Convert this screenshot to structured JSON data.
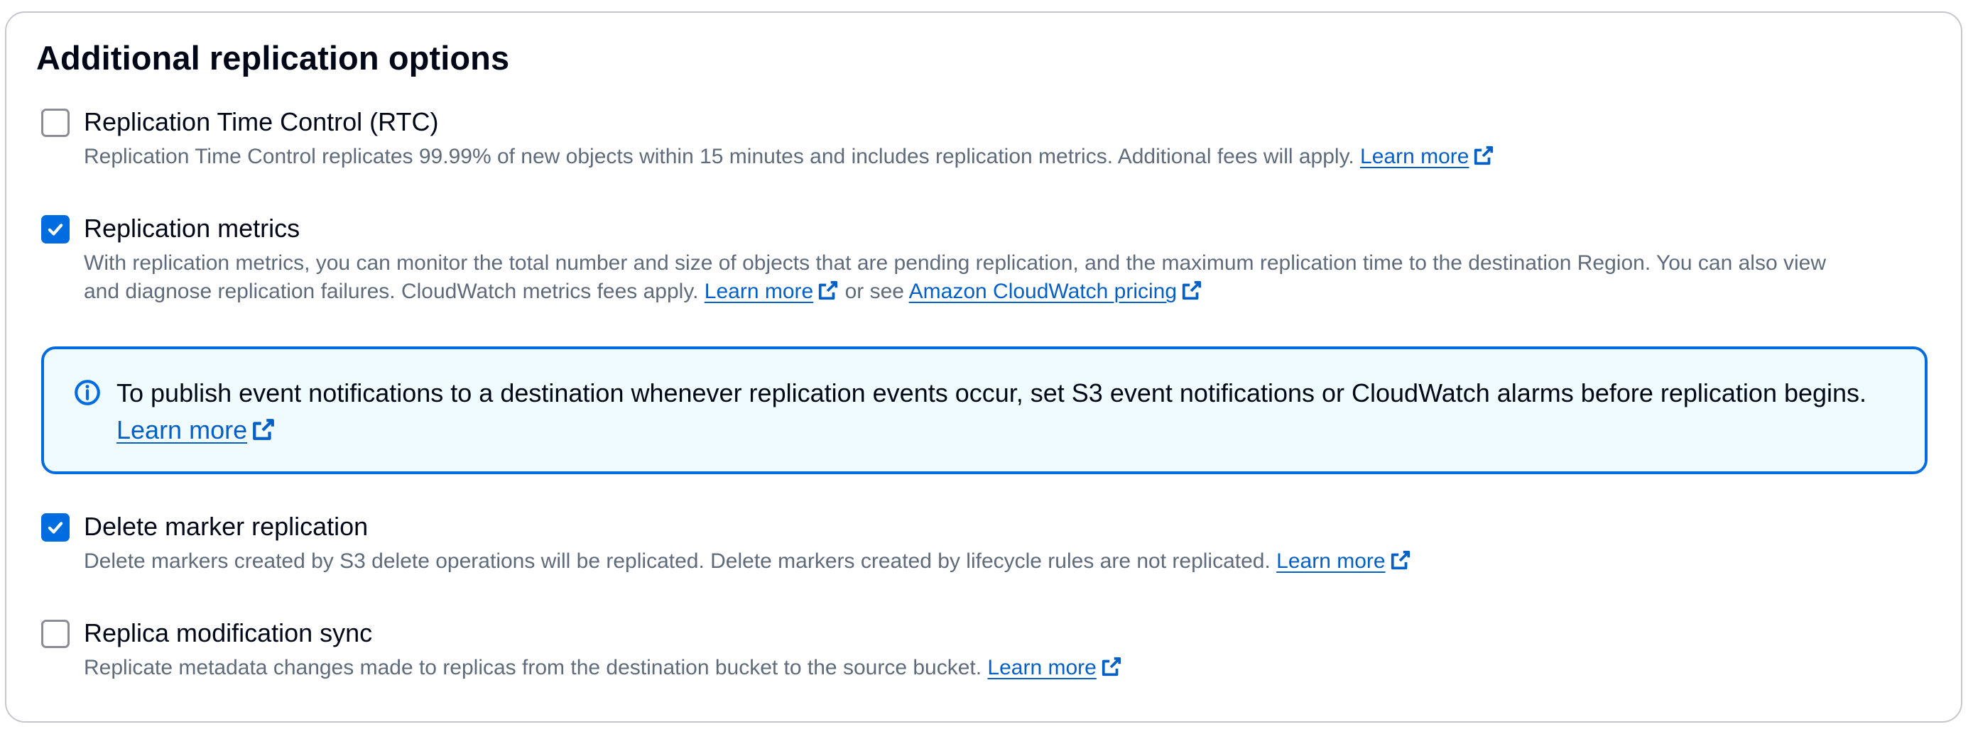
{
  "section": {
    "title": "Additional replication options"
  },
  "options": [
    {
      "label": "Replication Time Control (RTC)",
      "checked": false,
      "description": "Replication Time Control replicates 99.99% of new objects within 15 minutes and includes replication metrics. Additional fees will apply.",
      "link": "Learn more"
    },
    {
      "label": "Replication metrics",
      "checked": true,
      "description_line1": "With replication metrics, you can monitor the total number and size of objects that are pending replication, and the maximum replication time to the destination Region. You can also view",
      "description_line2": "and diagnose replication failures. CloudWatch metrics fees apply.",
      "link": "Learn more",
      "connector": "or see",
      "link2": "Amazon CloudWatch pricing"
    },
    {
      "label": "Delete marker replication",
      "checked": true,
      "description": "Delete markers created by S3 delete operations will be replicated. Delete markers created by lifecycle rules are not replicated.",
      "link": "Learn more"
    },
    {
      "label": "Replica modification sync",
      "checked": false,
      "description": "Replicate metadata changes made to replicas from the destination bucket to the source bucket.",
      "link": "Learn more"
    }
  ],
  "info": {
    "text": "To publish event notifications to a destination whenever replication events occur, set S3 event notifications or CloudWatch alarms before replication begins.",
    "link": "Learn more",
    "icon": "info-circle-icon"
  },
  "icons": {
    "external_link": "external-link-icon",
    "check": "checkmark-icon"
  },
  "colors": {
    "accent": "#006ce0",
    "link": "#0560c5",
    "text": "#000716",
    "secondary_text": "#5f6b7a",
    "info_background": "#f0fbff",
    "border": "#c6c6cd"
  }
}
